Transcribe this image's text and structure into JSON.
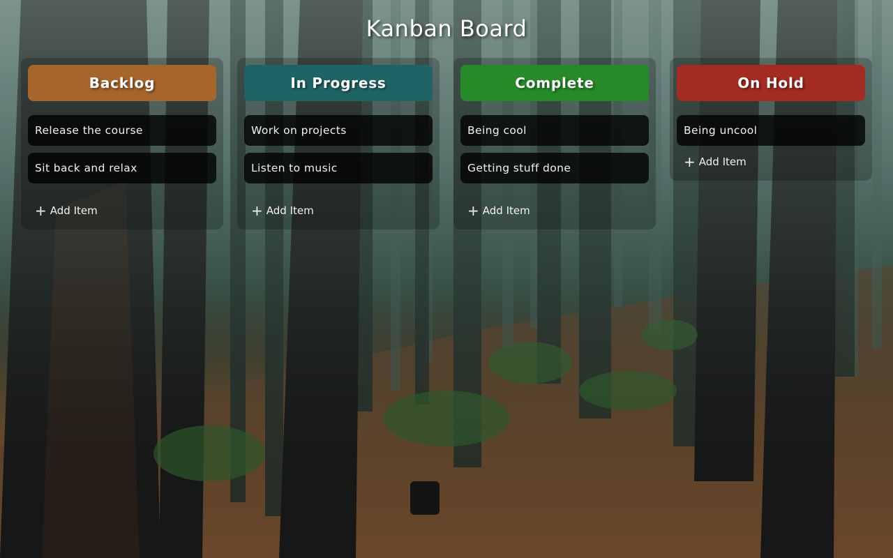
{
  "page": {
    "title": "Kanban Board"
  },
  "columns": [
    {
      "name": "Backlog",
      "color": "#a6652b",
      "items": [
        "Release the course",
        "Sit back and relax"
      ],
      "add_label": "Add Item"
    },
    {
      "name": "In Progress",
      "color": "#1f6464",
      "items": [
        "Work on projects",
        "Listen to music"
      ],
      "add_label": "Add Item"
    },
    {
      "name": "Complete",
      "color": "#278a29",
      "items": [
        "Being cool",
        "Getting stuff done"
      ],
      "add_label": "Add Item"
    },
    {
      "name": "On Hold",
      "color": "#a32b22",
      "items": [
        "Being uncool"
      ],
      "add_label": "Add Item"
    }
  ],
  "icons": {
    "add": "plus-icon"
  }
}
